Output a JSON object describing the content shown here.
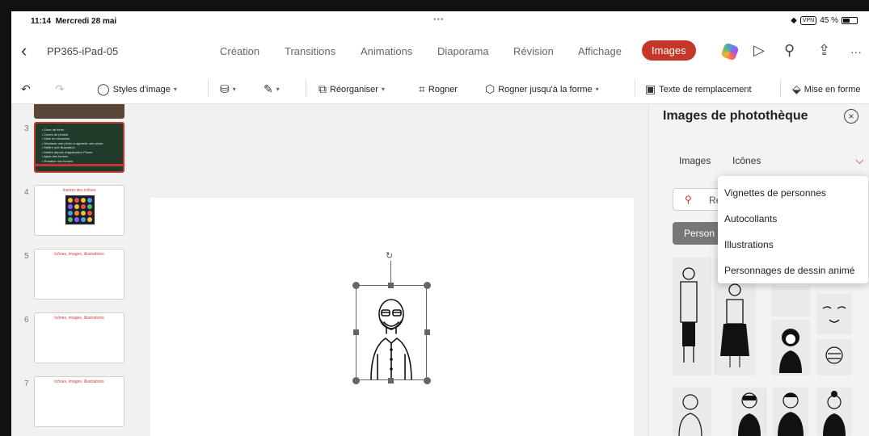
{
  "status_bar": {
    "time": "11:14",
    "date": "Mercredi 28 mai",
    "vpn": "VPN",
    "battery": "45 %",
    "multitask_dots": "•••"
  },
  "document": {
    "name": "PP365-iPad-05"
  },
  "tabs": [
    {
      "label": "Création"
    },
    {
      "label": "Transitions"
    },
    {
      "label": "Animations"
    },
    {
      "label": "Diaporama"
    },
    {
      "label": "Révision"
    },
    {
      "label": "Affichage"
    },
    {
      "label": "Images",
      "active": true
    }
  ],
  "ribbon": {
    "image_styles": "Styles d'image",
    "arrange": "Réorganiser",
    "crop": "Rogner",
    "crop_to_shape": "Rogner jusqu'à la forme",
    "alt_text": "Texte de remplacement",
    "format": "Mise en forme"
  },
  "slides": [
    {
      "number": "3",
      "lines": [
        "• Zone de titres",
        "• Zones de photos",
        "• Mise en encadrés",
        "• Déplacer une photo à agrandir une photo",
        "• Mettre une illustration",
        "• Mettre depuis d'application Plume",
        "• Ajout des formes",
        "• Rotation des formes"
      ]
    },
    {
      "number": "4",
      "title": "Insérer des icônes"
    },
    {
      "number": "5",
      "title": "Icônes, images, illustrations"
    },
    {
      "number": "6",
      "title": "Icônes, images, illustrations"
    },
    {
      "number": "7",
      "title": "Icônes, images, illustrations"
    }
  ],
  "panel": {
    "title": "Images de photothèque",
    "tabs": [
      "Images",
      "Icônes"
    ],
    "search_placeholder": "Re",
    "chip": "Person"
  },
  "dropdown": {
    "items": [
      "Vignettes de personnes",
      "Autocollants",
      "Illustrations",
      "Personnages de dessin animé"
    ]
  },
  "colors": {
    "accent": "#c4372a",
    "chip": "#777777"
  }
}
